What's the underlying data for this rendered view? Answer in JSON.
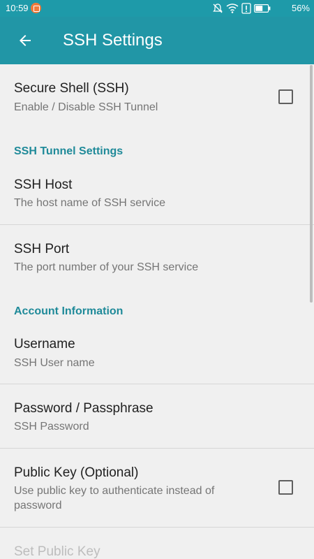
{
  "status_bar": {
    "time": "10:59",
    "battery_percent": "56%",
    "icons": [
      "notification-app-icon",
      "mute-icon",
      "wifi-icon",
      "alert-icon",
      "battery-icon"
    ]
  },
  "app_bar": {
    "title": "SSH Settings",
    "back_icon": "arrow-back-icon"
  },
  "colors": {
    "primary": "#2196a6",
    "accent_header": "#1f8a99"
  },
  "prefs": {
    "ssh": {
      "title": "Secure Shell (SSH)",
      "summary": "Enable / Disable SSH Tunnel",
      "checked": false
    },
    "tunnel_header": "SSH Tunnel Settings",
    "host": {
      "title": "SSH Host",
      "summary": "The host name of SSH service"
    },
    "port": {
      "title": "SSH Port",
      "summary": "The port number of your SSH service"
    },
    "account_header": "Account Information",
    "username": {
      "title": "Username",
      "summary": "SSH User name"
    },
    "password": {
      "title": "Password / Passphrase",
      "summary": "SSH Password"
    },
    "pubkey": {
      "title": "Public Key (Optional)",
      "summary": "Use public key to authenticate instead of password",
      "checked": false
    },
    "set_pubkey": {
      "title": "Set Public Key"
    }
  }
}
